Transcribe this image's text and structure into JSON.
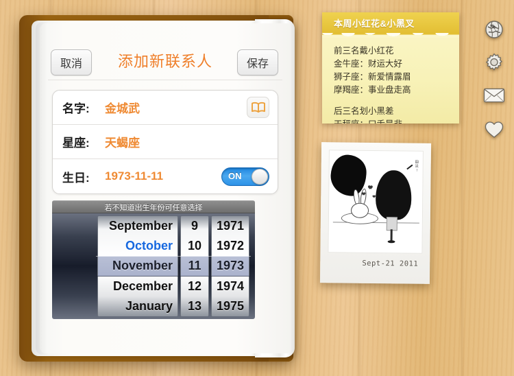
{
  "header": {
    "cancel_label": "取消",
    "title": "添加新联系人",
    "save_label": "保存"
  },
  "form": {
    "rows": [
      {
        "label": "名字:",
        "value": "金城武",
        "icon": "open-book-icon"
      },
      {
        "label": "星座:",
        "value": "天蝎座"
      },
      {
        "label": "生日:",
        "value": "1973-11-11",
        "toggle_state": "ON"
      }
    ]
  },
  "picker": {
    "hint": "若不知道出生年份可任意选择",
    "months": [
      "September",
      "October",
      "November",
      "December",
      "January"
    ],
    "days": [
      "9",
      "10",
      "11",
      "12",
      "13"
    ],
    "years": [
      "1971",
      "1972",
      "1973",
      "1974",
      "1975"
    ],
    "selected": {
      "month": "November",
      "day": "11",
      "year": "1973"
    },
    "highlighted_month": "October"
  },
  "note": {
    "title": "本周小红花&小黑叉",
    "lines": [
      "前三名戴小红花",
      "金牛座：财运大好",
      "狮子座：新爱情露眉",
      "摩羯座：事业盘走高",
      "",
      "后三名划小黑差",
      "天秤座：口舌是非"
    ]
  },
  "polaroid": {
    "caption": "Sept-21 2011"
  },
  "sidebar": {
    "items": [
      {
        "name": "globe-icon"
      },
      {
        "name": "gear-icon"
      },
      {
        "name": "mail-icon"
      },
      {
        "name": "heart-icon"
      }
    ]
  },
  "colors": {
    "accent_orange": "#ef8a33",
    "title_orange": "#ef7f2a",
    "toggle_blue": "#2e93e8",
    "note_yellow": "#fbf6c9",
    "note_header": "#e3bf34",
    "wood": "#e6bc80",
    "book_cover": "#8d5a10"
  }
}
